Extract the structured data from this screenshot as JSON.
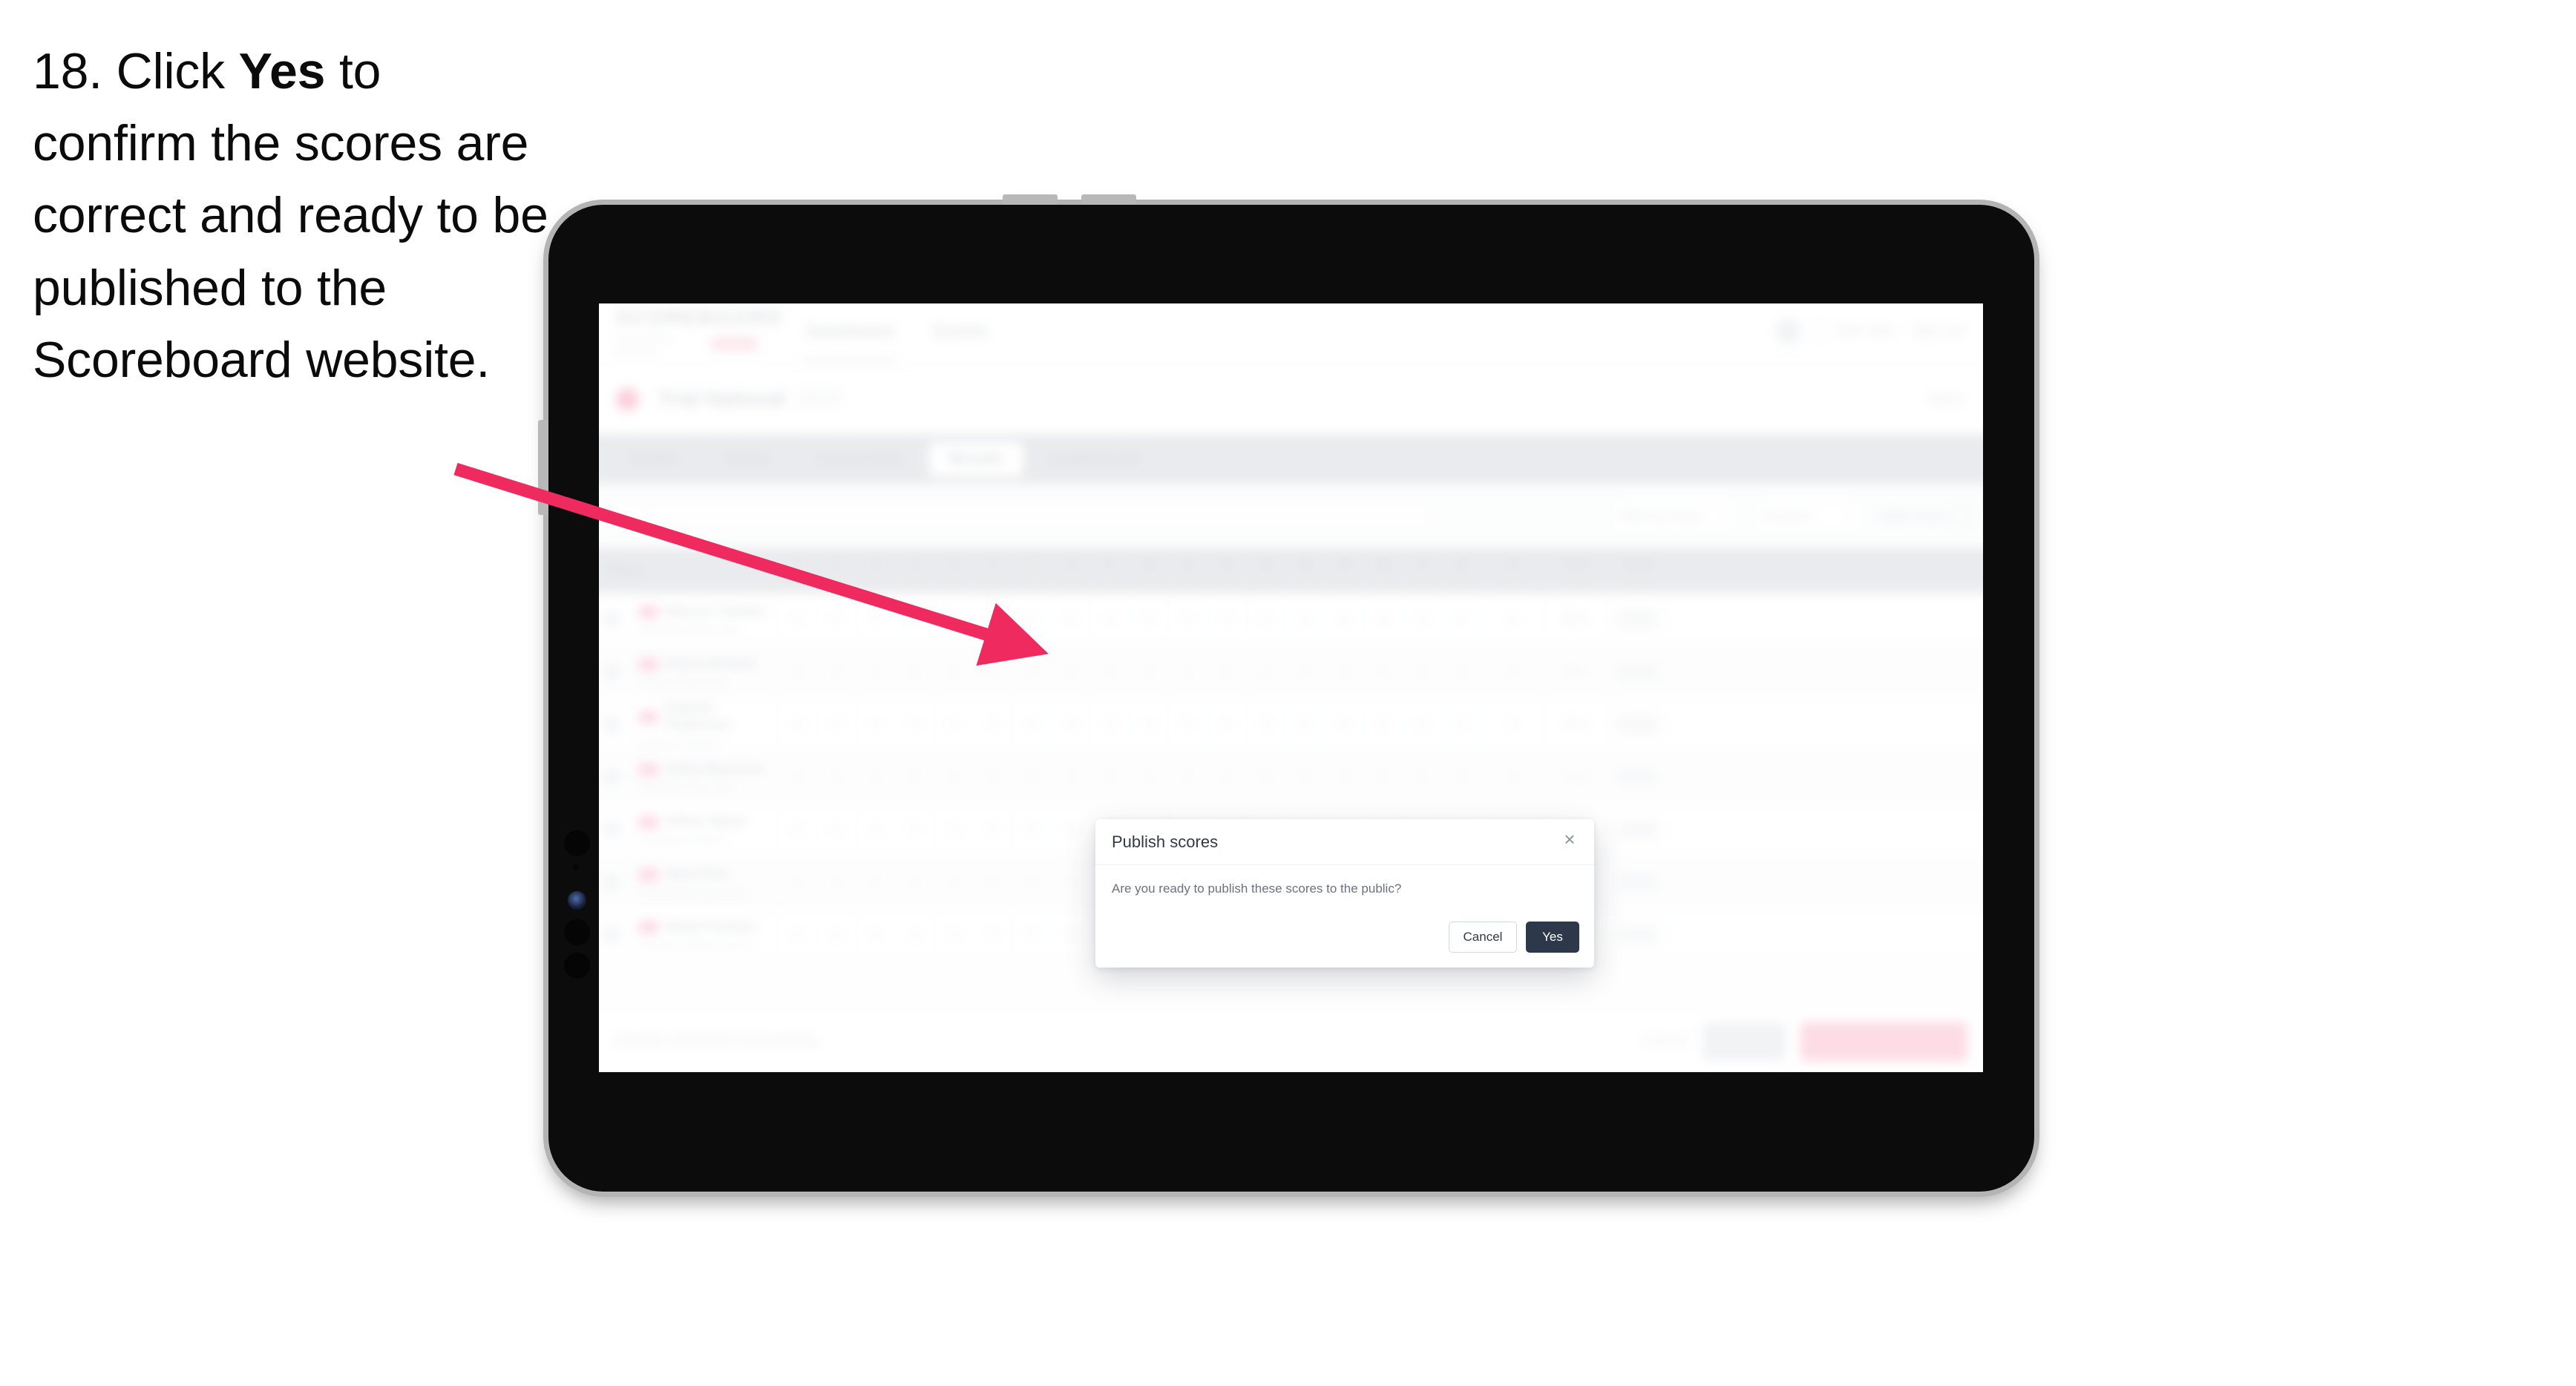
{
  "caption": {
    "number": "18.",
    "text_before": " Click ",
    "emphasis": "Yes",
    "text_after": " to confirm the scores are correct and ready to be published to the Scoreboard website."
  },
  "annotation": {
    "arrow_color": "#ee2a5e",
    "points_to": "Yes button in Publish scores dialog"
  },
  "device": {
    "type": "tablet",
    "frame_color": "#0c0c0c",
    "bezel_color": "#b4b4b4"
  },
  "app": {
    "logo": {
      "word": "SCOREBOARD",
      "subtitle": "Competition Manager",
      "pill": "BETA"
    },
    "nav": [
      {
        "label": "Dashboard",
        "active": true
      },
      {
        "label": "Events",
        "active": false
      }
    ],
    "header_right": {
      "user": "Test User",
      "logout": "Sign out"
    },
    "competition": {
      "name": "Trial National",
      "year": "2024",
      "back": "Back"
    },
    "tabs": [
      {
        "label": "Details",
        "active": false
      },
      {
        "label": "Teams",
        "active": false
      },
      {
        "label": "Course Data",
        "active": false
      },
      {
        "label": "Results",
        "active": true
      },
      {
        "label": "Leaderboard",
        "active": false
      }
    ],
    "filters": {
      "search_placeholder": "Search",
      "selects": [
        {
          "label": "Filter by class"
        },
        {
          "label": "Round 1"
        }
      ],
      "view_toggle": "Table View"
    },
    "table": {
      "columns": [
        {
          "label": "Player",
          "sub": ""
        },
        {
          "label": "1",
          "sub": "Fence"
        },
        {
          "label": "2",
          "sub": "Fence"
        },
        {
          "label": "3",
          "sub": "Fence"
        },
        {
          "label": "4",
          "sub": "Fence"
        },
        {
          "label": "5",
          "sub": "Fence"
        },
        {
          "label": "6",
          "sub": "Fence"
        },
        {
          "label": "7",
          "sub": "Fence"
        },
        {
          "label": "8",
          "sub": "Fence"
        },
        {
          "label": "9",
          "sub": "Fence"
        },
        {
          "label": "10",
          "sub": "Fence"
        },
        {
          "label": "11",
          "sub": "Fence"
        },
        {
          "label": "12",
          "sub": "Fence"
        },
        {
          "label": "13",
          "sub": "Fence"
        },
        {
          "label": "14",
          "sub": "Fence"
        },
        {
          "label": "15",
          "sub": "Fence"
        },
        {
          "label": "16",
          "sub": "Fence"
        },
        {
          "label": "17",
          "sub": "Fence"
        },
        {
          "label": "18",
          "sub": "Fence"
        },
        {
          "label": "TF",
          "sub": "Faults"
        },
        {
          "label": "Time",
          "sub": "secs"
        },
        {
          "label": "Score",
          "sub": "total"
        }
      ],
      "rows": [
        {
          "name": "Marcus Tanner",
          "club": "Westfield Riding Club",
          "time": "68.4",
          "faults": "0"
        },
        {
          "name": "Elena Rinaldi",
          "club": "Hillcrest Equestrian",
          "time": "69.1",
          "faults": "0"
        },
        {
          "name": "Gabriel Andersen",
          "club": "Oakmoor Stables",
          "time": "70.2",
          "faults": "4"
        },
        {
          "name": "Sofia Mazzone",
          "club": "Lakeview Pony Club",
          "time": "71.0",
          "faults": "4"
        },
        {
          "name": "Oliver Reed",
          "club": "Brambleton Riders",
          "time": "72.6",
          "faults": "8"
        },
        {
          "name": "Nora Kim",
          "club": "Stonebridge Equestrian",
          "time": "73.3",
          "faults": "8"
        },
        {
          "name": "Noah Fischer",
          "club": "Ashgrove Riding School",
          "time": "74.8",
          "faults": "12"
        }
      ]
    },
    "footer": {
      "note": "Results published successfully",
      "cancel": "Cancel",
      "save": "Save",
      "publish": "Publish results to public"
    }
  },
  "dialog": {
    "title": "Publish scores",
    "message": "Are you ready to publish these scores to the public?",
    "close_icon": "×",
    "cancel_label": "Cancel",
    "confirm_label": "Yes",
    "confirm_color": "#2d384b"
  }
}
